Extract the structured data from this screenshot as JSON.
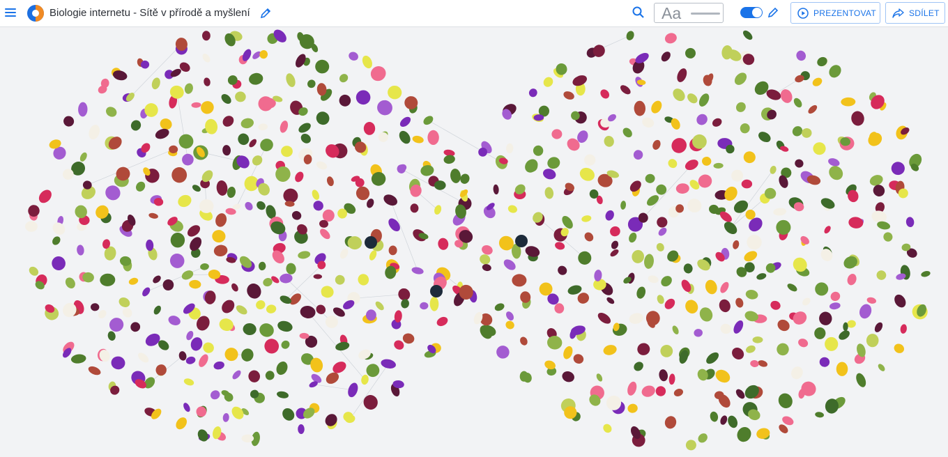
{
  "header": {
    "menu_icon": "hamburger-icon",
    "logo_icon": "app-logo",
    "title": "Biologie internetu - Sítě v přírodě a myšlení",
    "edit_icon": "pencil-icon",
    "search_icon": "search-icon",
    "font_sample": "Aa",
    "toggle_on": true,
    "pen_icon": "pen-icon",
    "present_label": "PREZENTOVAT",
    "present_icon": "play-circle-icon",
    "share_label": "SDÍLET",
    "share_icon": "share-arrow-icon"
  },
  "colors": {
    "accent": "#1a73e8",
    "canvas_bg": "#f2f3f5",
    "leaf_palette": [
      "#6b9a3a",
      "#4f7d2c",
      "#8fb34a",
      "#c0d05a",
      "#3e6b2a"
    ],
    "petal_palette": [
      "#d62b5b",
      "#f06b8f",
      "#7a2bb8",
      "#a35cd1",
      "#f2c21b",
      "#e6e64a",
      "#7b1d3d",
      "#5a1838",
      "#b04a3a",
      "#f4f0e6"
    ]
  },
  "canvas": {
    "description_free": true,
    "items_kind": "pressed flowers, petals and leaves connected by thin lines"
  }
}
